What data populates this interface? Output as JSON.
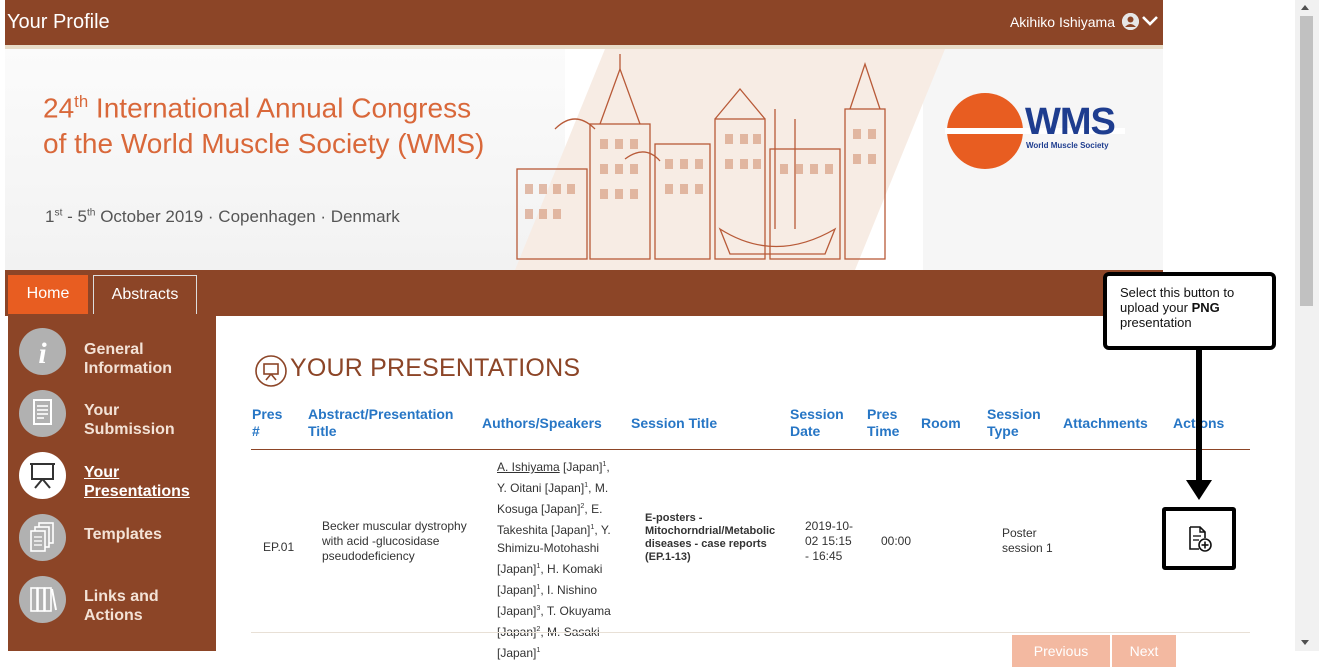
{
  "topbar": {
    "title": "Your Profile",
    "user_name": "Akihiko Ishiyama"
  },
  "banner": {
    "line1_num": "24",
    "line1_sup": "th",
    "line1_rest": " International Annual Congress",
    "line2": "of the World Muscle Society (WMS)",
    "date_1": "1",
    "date_1_sup": "st",
    "date_mid": " - 5",
    "date_2_sup": "th",
    "date_rest": " October 2019 · Copenhagen · Denmark",
    "logo_text": "WMS",
    "logo_sub": "World Muscle Society"
  },
  "nav": {
    "tabs": [
      {
        "label": "Home"
      },
      {
        "label": "Abstracts"
      }
    ]
  },
  "sidebar": {
    "items": [
      {
        "label1": "General",
        "label2": "Information"
      },
      {
        "label1": "Your",
        "label2": "Submission"
      },
      {
        "label1": "Your",
        "label2": "Presentations"
      },
      {
        "label1": "Templates",
        "label2": ""
      },
      {
        "label1": "Links and",
        "label2": "Actions"
      }
    ]
  },
  "main": {
    "heading": "YOUR PRESENTATIONS",
    "columns": [
      {
        "l1": "Pres",
        "l2": "#"
      },
      {
        "l1": "Abstract/Presentation",
        "l2": "Title"
      },
      {
        "l1": "Authors/Speakers",
        "l2": ""
      },
      {
        "l1": "Session Title",
        "l2": ""
      },
      {
        "l1": "Session",
        "l2": "Date"
      },
      {
        "l1": "Pres",
        "l2": "Time"
      },
      {
        "l1": "Room",
        "l2": ""
      },
      {
        "l1": "Session",
        "l2": "Type"
      },
      {
        "l1": "Attachments",
        "l2": ""
      },
      {
        "l1": "Actions",
        "l2": ""
      }
    ],
    "row": {
      "pres_no": "EP.01",
      "title_lines": [
        "Becker muscular dystrophy",
        "with acid -glucosidase",
        "pseudodeficiency"
      ],
      "authors": {
        "a1": "A. Ishiyama",
        "a1b": " [Japan]",
        "a1s": "1",
        "a1c": ",",
        "a2": "Y. Oitani [Japan]",
        "a2s": "1",
        "a2c": ", M.",
        "a3": "Kosuga [Japan]",
        "a3s": "2",
        "a3c": ", E.",
        "a4": "Takeshita [Japan]",
        "a4s": "1",
        "a4c": ", Y.",
        "a5": "Shimizu-Motohashi",
        "a6": "[Japan]",
        "a6s": "1",
        "a6c": ", H. Komaki",
        "a7": "[Japan]",
        "a7s": "1",
        "a7c": ", I. Nishino",
        "a8": "[Japan]",
        "a8s": "3",
        "a8c": ", T. Okuyama",
        "a9": "[Japan]",
        "a9s": "2",
        "a9c": ", M. Sasaki",
        "a10": "[Japan]",
        "a10s": "1"
      },
      "session_title_lines": [
        "E-posters -",
        "Mitochorndrial/Metabolic",
        "diseases - case reports",
        "(EP.1-13)"
      ],
      "date_lines": [
        "2019-10-",
        "02 15:15",
        "- 16:45"
      ],
      "time": "00:00",
      "room": "",
      "type_lines": [
        "Poster",
        "session 1"
      ]
    },
    "pager": {
      "previous": "Previous",
      "next": "Next"
    }
  },
  "callout": {
    "line1": "Select this button to",
    "line2a": "upload your ",
    "line2b": "PNG",
    "line3": "presentation"
  },
  "colors": {
    "brown": "#8c4527",
    "orange": "#e85d21",
    "blue": "#2776c5",
    "title_orange": "#d9683a"
  }
}
